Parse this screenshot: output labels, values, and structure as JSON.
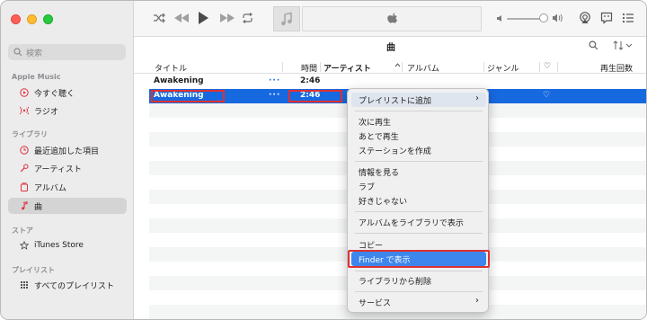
{
  "sidebar": {
    "search_placeholder": "検索",
    "sections": [
      {
        "title": "Apple Music",
        "items": [
          {
            "label": "今すぐ聴く",
            "icon": "play-circle-icon"
          },
          {
            "label": "ラジオ",
            "icon": "radio-waves-icon"
          }
        ]
      },
      {
        "title": "ライブラリ",
        "items": [
          {
            "label": "最近追加した項目",
            "icon": "clock-icon"
          },
          {
            "label": "アーティスト",
            "icon": "microphone-icon"
          },
          {
            "label": "アルバム",
            "icon": "album-icon"
          },
          {
            "label": "曲",
            "icon": "music-note-icon",
            "active": true
          }
        ]
      },
      {
        "title": "ストア",
        "items": [
          {
            "label": "iTunes Store",
            "icon": "star-icon"
          }
        ]
      },
      {
        "title": "プレイリスト",
        "items": [
          {
            "label": "すべてのプレイリスト",
            "icon": "grid-icon"
          }
        ]
      }
    ]
  },
  "list": {
    "title": "曲",
    "columns": [
      "タイトル",
      "時間",
      "アーティスト",
      "アルバム",
      "ジャンル",
      "♡",
      "再生回数"
    ],
    "rows": [
      {
        "title": "Awakening",
        "more": "···",
        "time": "2:46",
        "selected": false
      },
      {
        "title": "Awakening",
        "more": "···",
        "time": "2:46",
        "selected": true,
        "heart": "♡"
      }
    ]
  },
  "context_menu": {
    "items": [
      {
        "label": "プレイリストに追加",
        "submenu": true
      },
      {
        "label": "次に再生"
      },
      {
        "label": "あとで再生"
      },
      {
        "label": "ステーションを作成"
      },
      {
        "label": "情報を見る"
      },
      {
        "label": "ラブ"
      },
      {
        "label": "好きじゃない"
      },
      {
        "label": "アルバムをライブラリで表示"
      },
      {
        "label": "コピー"
      },
      {
        "label": "Finder で表示",
        "highlighted": true
      },
      {
        "label": "ライブラリから削除"
      },
      {
        "label": "サービス",
        "submenu": true
      }
    ],
    "submenu_arrow": "›"
  },
  "colors": {
    "selection": "#1769e0",
    "menu_highlight": "#3d86ee",
    "annotation_red": "#e03131"
  }
}
